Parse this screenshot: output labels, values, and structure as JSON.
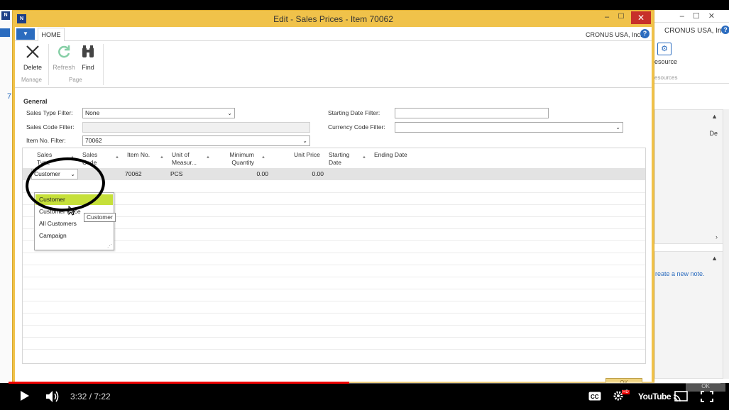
{
  "background_app": {
    "logo": "N",
    "company": "CRONUS USA, Inc.",
    "help": "?",
    "left_number": "7",
    "ribbon_button": "esource",
    "ribbon_group": "esources",
    "panel_text": "De",
    "note_link": "reate a new note."
  },
  "dialog": {
    "logo": "N",
    "title": "Edit - Sales Prices - Item 70062",
    "min": "–",
    "max": "☐",
    "close": "✕",
    "company": "CRONUS USA, Inc.",
    "help": "?",
    "app_menu_icon": "▼",
    "tab_home": "HOME",
    "ribbon": {
      "delete": "Delete",
      "refresh": "Refresh",
      "find": "Find",
      "group_manage": "Manage",
      "group_page": "Page"
    },
    "general": {
      "title": "General",
      "sales_type_filter_label": "Sales Type Filter:",
      "sales_type_filter_value": "None",
      "sales_code_filter_label": "Sales Code Filter:",
      "sales_code_filter_value": "",
      "item_no_filter_label": "Item No. Filter:",
      "item_no_filter_value": "70062",
      "starting_date_filter_label": "Starting Date Filter:",
      "starting_date_filter_value": "",
      "currency_code_filter_label": "Currency Code Filter:",
      "currency_code_filter_value": ""
    },
    "grid": {
      "columns": {
        "sales_type": [
          "Sales",
          "Type"
        ],
        "sales_code": [
          "Sales",
          "Code"
        ],
        "item_no": "Item No.",
        "unit_of_measure": [
          "Unit of",
          "Measur..."
        ],
        "minimum_quantity": [
          "Minimum",
          "Quantity"
        ],
        "unit_price": "Unit Price",
        "starting_date": [
          "Starting",
          "Date"
        ],
        "ending_date": "Ending Date"
      },
      "row": {
        "sales_type": "Customer",
        "item_no": "70062",
        "unit_of_measure": "PCS",
        "minimum_quantity": "0.00",
        "unit_price": "0.00"
      }
    },
    "dropdown_options": [
      "Customer",
      "Customer Price",
      "All Customers",
      "Campaign"
    ],
    "tooltip": "Customer",
    "ok_ghost": "OK"
  },
  "player": {
    "progress": 0.479,
    "time": "3:32 / 7:22",
    "youtube": "YouTube",
    "hd": "HD",
    "ok_bg": "OK"
  }
}
